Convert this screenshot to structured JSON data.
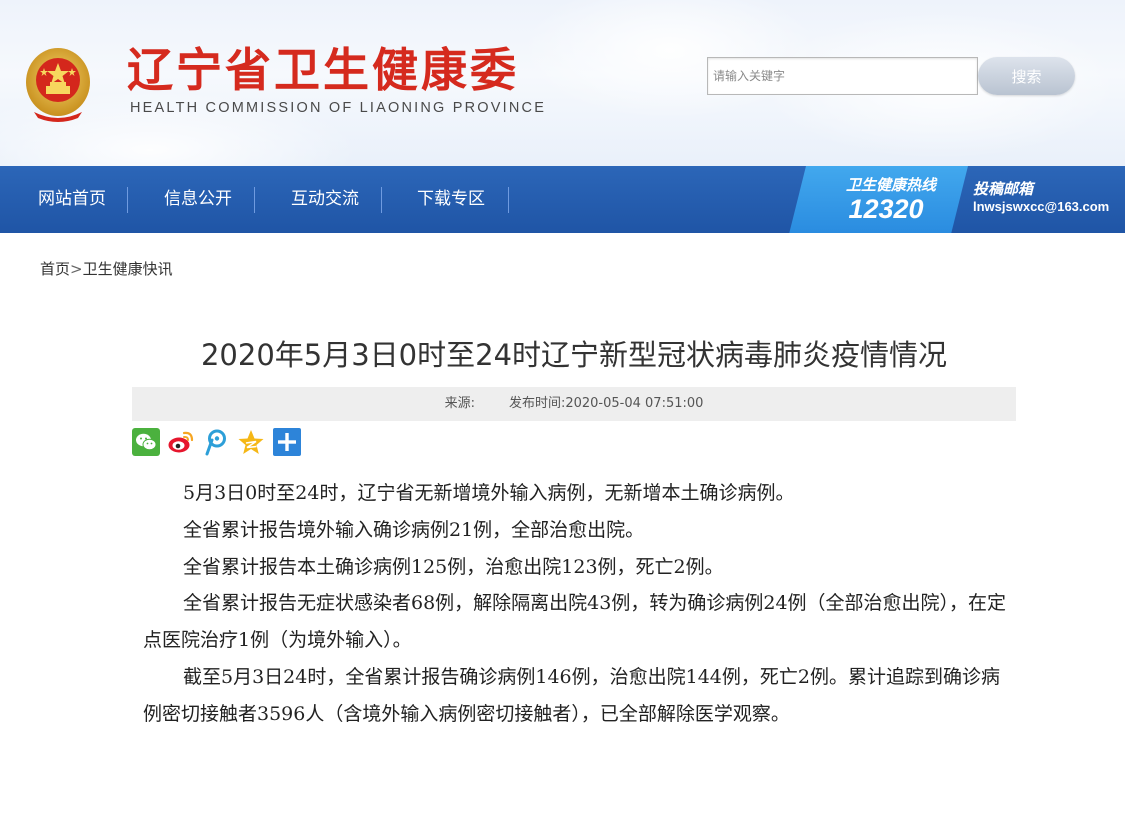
{
  "header": {
    "site_title": "辽宁省卫生健康委",
    "site_subtitle": "HEALTH COMMISSION OF LIAONING PROVINCE",
    "search": {
      "placeholder": "请输入关键字",
      "button_label": "搜索"
    }
  },
  "nav": {
    "items": [
      {
        "label": "网站首页"
      },
      {
        "label": "信息公开"
      },
      {
        "label": "互动交流"
      },
      {
        "label": "下载专区"
      }
    ],
    "hotline_label": "卫生健康热线",
    "hotline_number": "12320",
    "mail_label": "投稿邮箱",
    "mail_address": "lnwsjswxcc@163.com"
  },
  "breadcrumb": {
    "home": "首页",
    "separator": ">",
    "current": "卫生健康快讯"
  },
  "article": {
    "title": "2020年5月3日0时至24时辽宁新型冠状病毒肺炎疫情情况",
    "source_label": "来源:",
    "publish_label": "发布时间:",
    "publish_time": "2020-05-04 07:51:00",
    "share_icons": [
      "wechat-icon",
      "weibo-icon",
      "tencent-weibo-icon",
      "qzone-icon",
      "more-share-icon"
    ],
    "paragraphs": [
      "5月3日0时至24时，辽宁省无新增境外输入病例，无新增本土确诊病例。",
      "全省累计报告境外输入确诊病例21例，全部治愈出院。",
      "全省累计报告本土确诊病例125例，治愈出院123例，死亡2例。",
      "全省累计报告无症状感染者68例，解除隔离出院43例，转为确诊病例24例（全部治愈出院），在定点医院治疗1例（为境外输入）。",
      "截至5月3日24时，全省累计报告确诊病例146例，治愈出院144例，死亡2例。累计追踪到确诊病例密切接触者3596人（含境外输入病例密切接触者），已全部解除医学观察。"
    ]
  },
  "colors": {
    "brand_red": "#d52a1e",
    "nav_blue": "#1f55a6",
    "hotline_blue": "#2a8ce0"
  }
}
